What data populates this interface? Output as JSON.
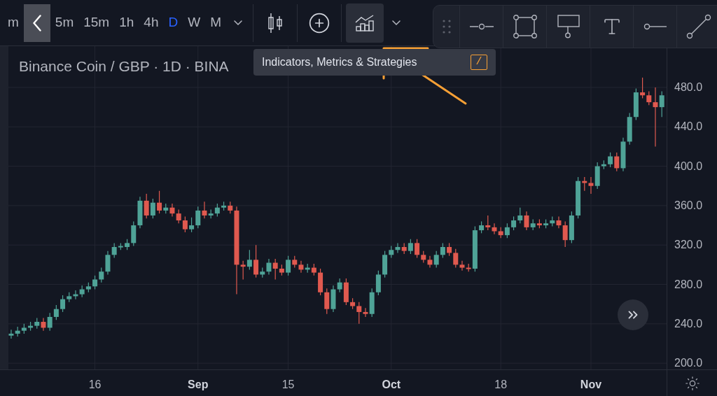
{
  "toolbar": {
    "intervals": [
      {
        "label": "m",
        "selected": false
      },
      {
        "label": "5m",
        "selected": false
      },
      {
        "label": "15m",
        "selected": false
      },
      {
        "label": "1h",
        "selected": false
      },
      {
        "label": "4h",
        "selected": false
      },
      {
        "label": "D",
        "selected": true
      },
      {
        "label": "W",
        "selected": false
      },
      {
        "label": "M",
        "selected": false
      }
    ],
    "tooltip": {
      "text": "Indicators, Metrics & Strategies",
      "shortcut": "/"
    }
  },
  "legend": "Binance Coin / GBP · 1D · BINA",
  "chart": {
    "chart_data": {
      "type": "candlestick",
      "grid": true,
      "ylim": [
        193.7,
        521.9
      ],
      "yticks": [
        {
          "value": 480,
          "label": "480.0"
        },
        {
          "value": 440,
          "label": "440.0"
        },
        {
          "value": 400,
          "label": "400.0"
        },
        {
          "value": 360,
          "label": "360.0"
        },
        {
          "value": 320,
          "label": "320.0"
        },
        {
          "value": 280,
          "label": "280.0"
        },
        {
          "value": 240,
          "label": "240.0"
        },
        {
          "value": 200,
          "label": "200.0"
        }
      ],
      "categories": [
        null,
        null,
        null,
        null,
        null,
        null,
        null,
        null,
        null,
        null,
        null,
        null,
        null,
        "16",
        null,
        null,
        null,
        null,
        null,
        null,
        null,
        null,
        null,
        null,
        null,
        null,
        null,
        null,
        null,
        "Sep",
        null,
        null,
        null,
        null,
        null,
        null,
        null,
        null,
        null,
        null,
        null,
        null,
        null,
        "15",
        null,
        null,
        null,
        null,
        null,
        null,
        null,
        null,
        null,
        null,
        null,
        null,
        null,
        null,
        null,
        "Oct",
        null,
        null,
        null,
        null,
        null,
        null,
        null,
        null,
        null,
        null,
        null,
        null,
        null,
        null,
        null,
        null,
        "18",
        null,
        null,
        null,
        null,
        null,
        null,
        null,
        null,
        null,
        null,
        null,
        null,
        null,
        "Nov",
        null,
        null,
        null,
        null,
        null,
        null,
        null,
        null,
        null,
        null,
        null
      ],
      "ohlc": [
        [
          228,
          234,
          225,
          230
        ],
        [
          230,
          237,
          227,
          233
        ],
        [
          233,
          240,
          230,
          236
        ],
        [
          236,
          242,
          233,
          238
        ],
        [
          238,
          246,
          235,
          242
        ],
        [
          242,
          246,
          233,
          236
        ],
        [
          236,
          251,
          233,
          247
        ],
        [
          247,
          259,
          244,
          255
        ],
        [
          255,
          269,
          252,
          265
        ],
        [
          265,
          272,
          262,
          268
        ],
        [
          268,
          274,
          265,
          270
        ],
        [
          270,
          279,
          267,
          275
        ],
        [
          275,
          282,
          272,
          278
        ],
        [
          278,
          289,
          275,
          285
        ],
        [
          285,
          297,
          282,
          293
        ],
        [
          293,
          314,
          290,
          310
        ],
        [
          310,
          322,
          307,
          318
        ],
        [
          318,
          322,
          315,
          319
        ],
        [
          318,
          326,
          315,
          322
        ],
        [
          322,
          344,
          319,
          340
        ],
        [
          340,
          369,
          337,
          365
        ],
        [
          365,
          372,
          347,
          350
        ],
        [
          350,
          367,
          347,
          363
        ],
        [
          363,
          375,
          352,
          355
        ],
        [
          355,
          362,
          352,
          358
        ],
        [
          358,
          362,
          349,
          352
        ],
        [
          352,
          356,
          342,
          345
        ],
        [
          345,
          349,
          333,
          336
        ],
        [
          336,
          348,
          333,
          340
        ],
        [
          340,
          359,
          337,
          355
        ],
        [
          355,
          364,
          347,
          350
        ],
        [
          350,
          356,
          347,
          352
        ],
        [
          352,
          362,
          349,
          358
        ],
        [
          358,
          364,
          355,
          360
        ],
        [
          360,
          364,
          352,
          355
        ],
        [
          355,
          359,
          270,
          300
        ],
        [
          300,
          304,
          285,
          298
        ],
        [
          298,
          315,
          295,
          305
        ],
        [
          305,
          320,
          287,
          290
        ],
        [
          290,
          297,
          287,
          293
        ],
        [
          293,
          306,
          290,
          302
        ],
        [
          302,
          306,
          285,
          296
        ],
        [
          296,
          300,
          289,
          292
        ],
        [
          292,
          309,
          289,
          305
        ],
        [
          305,
          309,
          297,
          300
        ],
        [
          300,
          304,
          292,
          295
        ],
        [
          295,
          301,
          292,
          297
        ],
        [
          297,
          301,
          289,
          292
        ],
        [
          292,
          296,
          269,
          272
        ],
        [
          272,
          276,
          250,
          255
        ],
        [
          255,
          279,
          252,
          275
        ],
        [
          275,
          286,
          272,
          282
        ],
        [
          282,
          286,
          259,
          262
        ],
        [
          262,
          266,
          255,
          258
        ],
        [
          258,
          262,
          240,
          252
        ],
        [
          252,
          256,
          247,
          250
        ],
        [
          250,
          276,
          247,
          272
        ],
        [
          272,
          294,
          269,
          290
        ],
        [
          290,
          314,
          287,
          310
        ],
        [
          310,
          319,
          307,
          315
        ],
        [
          315,
          322,
          312,
          318
        ],
        [
          318,
          322,
          311,
          314
        ],
        [
          314,
          326,
          311,
          322
        ],
        [
          322,
          326,
          307,
          310
        ],
        [
          310,
          314,
          302,
          305
        ],
        [
          305,
          309,
          297,
          300
        ],
        [
          300,
          314,
          297,
          310
        ],
        [
          310,
          322,
          307,
          318
        ],
        [
          318,
          322,
          309,
          312
        ],
        [
          312,
          316,
          297,
          300
        ],
        [
          300,
          304,
          294,
          297
        ],
        [
          297,
          301,
          293,
          296
        ],
        [
          296,
          339,
          293,
          335
        ],
        [
          335,
          344,
          332,
          340
        ],
        [
          340,
          350,
          335,
          338
        ],
        [
          338,
          342,
          331,
          334
        ],
        [
          334,
          338,
          327,
          330
        ],
        [
          330,
          342,
          327,
          338
        ],
        [
          338,
          349,
          335,
          345
        ],
        [
          345,
          358,
          342,
          350
        ],
        [
          350,
          354,
          335,
          338
        ],
        [
          338,
          346,
          335,
          342
        ],
        [
          342,
          346,
          337,
          340
        ],
        [
          340,
          346,
          337,
          342
        ],
        [
          342,
          349,
          339,
          345
        ],
        [
          345,
          349,
          337,
          340
        ],
        [
          340,
          344,
          318,
          325
        ],
        [
          325,
          354,
          322,
          350
        ],
        [
          350,
          389,
          347,
          385
        ],
        [
          385,
          389,
          375,
          383
        ],
        [
          383,
          389,
          372,
          380
        ],
        [
          380,
          404,
          377,
          400
        ],
        [
          400,
          406,
          397,
          402
        ],
        [
          402,
          414,
          399,
          410
        ],
        [
          410,
          414,
          395,
          398
        ],
        [
          398,
          429,
          395,
          425
        ],
        [
          425,
          454,
          422,
          450
        ],
        [
          450,
          479,
          447,
          475
        ],
        [
          475,
          490,
          469,
          472
        ],
        [
          472,
          476,
          462,
          465
        ],
        [
          465,
          480,
          420,
          460
        ],
        [
          460,
          476,
          450,
          472
        ]
      ]
    }
  },
  "time_axis": {
    "label_bold": [
      false,
      true,
      false,
      true,
      false,
      true
    ]
  }
}
